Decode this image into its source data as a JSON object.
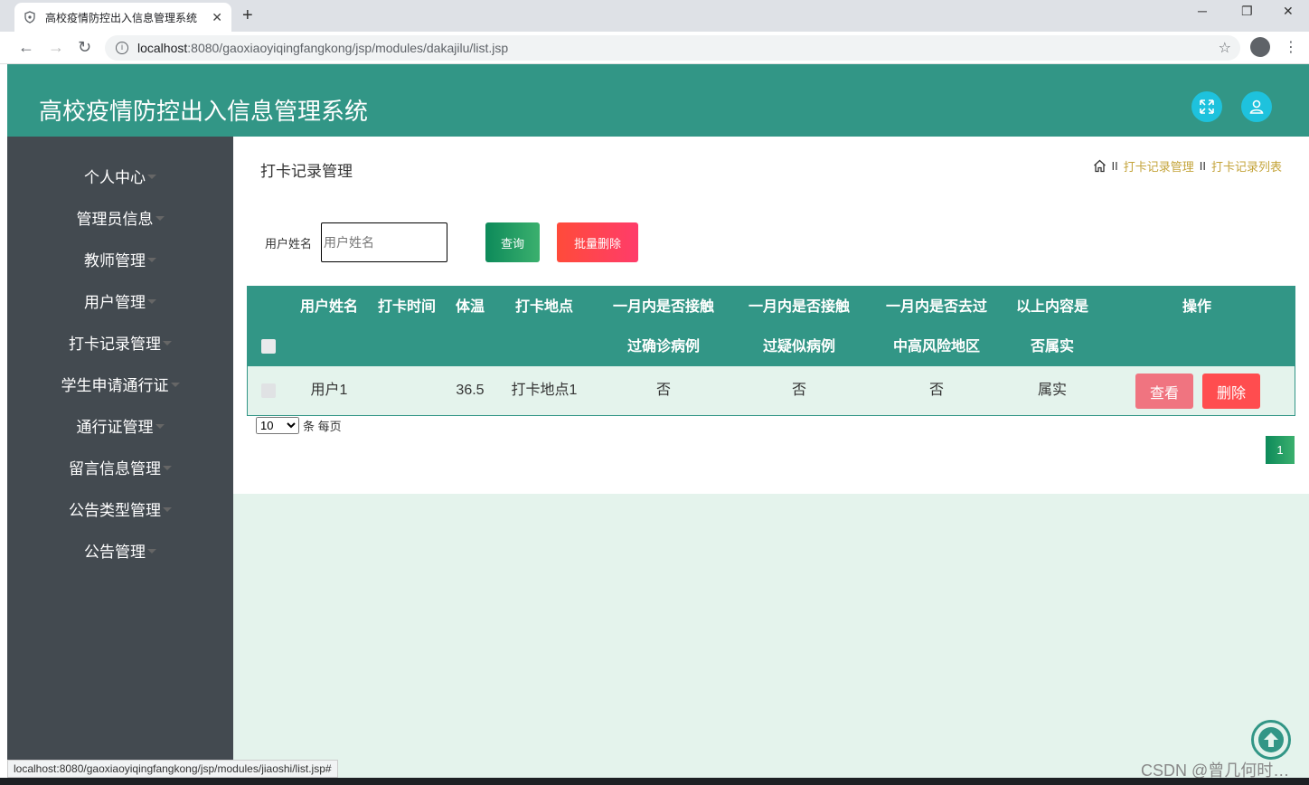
{
  "browser": {
    "tab_title": "高校疫情防控出入信息管理系统",
    "tab_close": "✕",
    "new_tab": "+",
    "url_host": "localhost",
    "url_path": ":8080/gaoxiaoyiqingfangkong/jsp/modules/dakajilu/list.jsp",
    "status_url": "localhost:8080/gaoxiaoyiqingfangkong/jsp/modules/jiaoshi/list.jsp#"
  },
  "header": {
    "title": "高校疫情防控出入信息管理系统"
  },
  "sidebar": {
    "items": [
      {
        "label": "个人中心"
      },
      {
        "label": "管理员信息"
      },
      {
        "label": "教师管理"
      },
      {
        "label": "用户管理"
      },
      {
        "label": "打卡记录管理"
      },
      {
        "label": "学生申请通行证"
      },
      {
        "label": "通行证管理"
      },
      {
        "label": "留言信息管理"
      },
      {
        "label": "公告类型管理"
      },
      {
        "label": "公告管理"
      }
    ]
  },
  "main": {
    "page_title": "打卡记录管理",
    "breadcrumb": {
      "sep": "II",
      "items": [
        "打卡记录管理",
        "打卡记录列表"
      ]
    },
    "search": {
      "label": "用户姓名",
      "placeholder": "用户姓名",
      "query_button": "查询",
      "batch_delete_button": "批量删除"
    },
    "table": {
      "headers": [
        {
          "line1": "用户姓名",
          "line2": ""
        },
        {
          "line1": "打卡时间",
          "line2": ""
        },
        {
          "line1": "体温",
          "line2": ""
        },
        {
          "line1": "打卡地点",
          "line2": ""
        },
        {
          "line1": "一月内是否接触",
          "line2": "过确诊病例"
        },
        {
          "line1": "一月内是否接触",
          "line2": "过疑似病例"
        },
        {
          "line1": "一月内是否去过",
          "line2": "中高风险地区"
        },
        {
          "line1": "以上内容是",
          "line2": "否属实"
        },
        {
          "line1": "操作",
          "line2": ""
        }
      ],
      "rows": [
        {
          "user_name": "用户1",
          "check_time": "",
          "temperature": "36.5",
          "location": "打卡地点1",
          "contact_confirmed": "否",
          "contact_suspected": "否",
          "risk_area": "否",
          "truthful": "属实",
          "view_label": "查看",
          "delete_label": "删除"
        }
      ]
    },
    "pagination": {
      "page_size": "10",
      "page_size_suffix": "条 每页",
      "current_page": "1"
    }
  },
  "watermark": "CSDN @曾几何时…",
  "colors": {
    "header": "#329686",
    "sidebar": "#434a50",
    "content_bg": "#e4f3ec",
    "breadcrumb": "#c4a43b",
    "danger": "#ff4d4f"
  }
}
